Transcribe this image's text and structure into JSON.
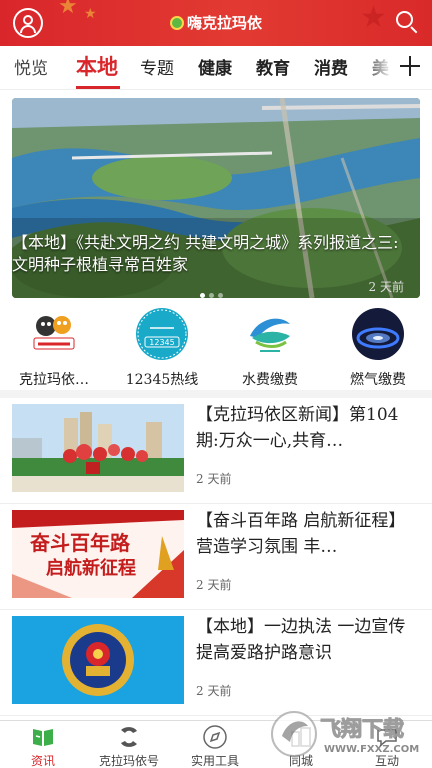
{
  "header": {
    "title": "嗨克拉玛依",
    "user_icon": "user-icon",
    "search_icon": "search-icon",
    "bg_color": "#d9262b"
  },
  "tabs": [
    {
      "label": "悦览"
    },
    {
      "label": "本地",
      "active": true
    },
    {
      "label": "专题"
    },
    {
      "label": "健康"
    },
    {
      "label": "教育"
    },
    {
      "label": "消费"
    },
    {
      "label": "美"
    }
  ],
  "tab_add_icon": "plus-icon",
  "banner": {
    "caption": "【本地】《共赴文明之约 共建文明之城》系列报道之三:文明种子根植寻常百姓家",
    "time": "2 天前",
    "dots": 3,
    "active_dot": 1
  },
  "services": [
    {
      "label": "克拉玛依…",
      "icon": "karamay-mascot-icon"
    },
    {
      "label": "12345热线",
      "icon": "hotline-12345-icon",
      "icon_text": "12345"
    },
    {
      "label": "水费缴费",
      "icon": "water-bill-icon"
    },
    {
      "label": "燃气缴费",
      "icon": "gas-bill-icon"
    }
  ],
  "news": [
    {
      "title": "【克拉玛依区新闻】第104期:万众一心,共育…",
      "time": "2 天前",
      "thumb": "city-flowers-thumb"
    },
    {
      "title": "【奋斗百年路 启航新征程】营造学习氛围 丰…",
      "time": "2 天前",
      "thumb": "centenary-banner-thumb",
      "thumb_text": [
        "奋斗百年路",
        "启航新征程"
      ]
    },
    {
      "title": "【本地】一边执法 一边宣传 提高爱路护路意识",
      "time": "2 天前",
      "thumb": "police-emblem-thumb"
    }
  ],
  "bottom_nav": [
    {
      "label": "资讯",
      "icon": "news-book-icon",
      "active": true
    },
    {
      "label": "克拉玛依号",
      "icon": "karamay-account-icon"
    },
    {
      "label": "实用工具",
      "icon": "compass-tools-icon"
    },
    {
      "label": "同城",
      "icon": "local-city-icon"
    },
    {
      "label": "互动",
      "icon": "interact-icon"
    }
  ],
  "watermark": {
    "text": "飞翔下载",
    "url_text": "WWW.FXXZ.COM"
  },
  "accent_color": "#d9262b"
}
